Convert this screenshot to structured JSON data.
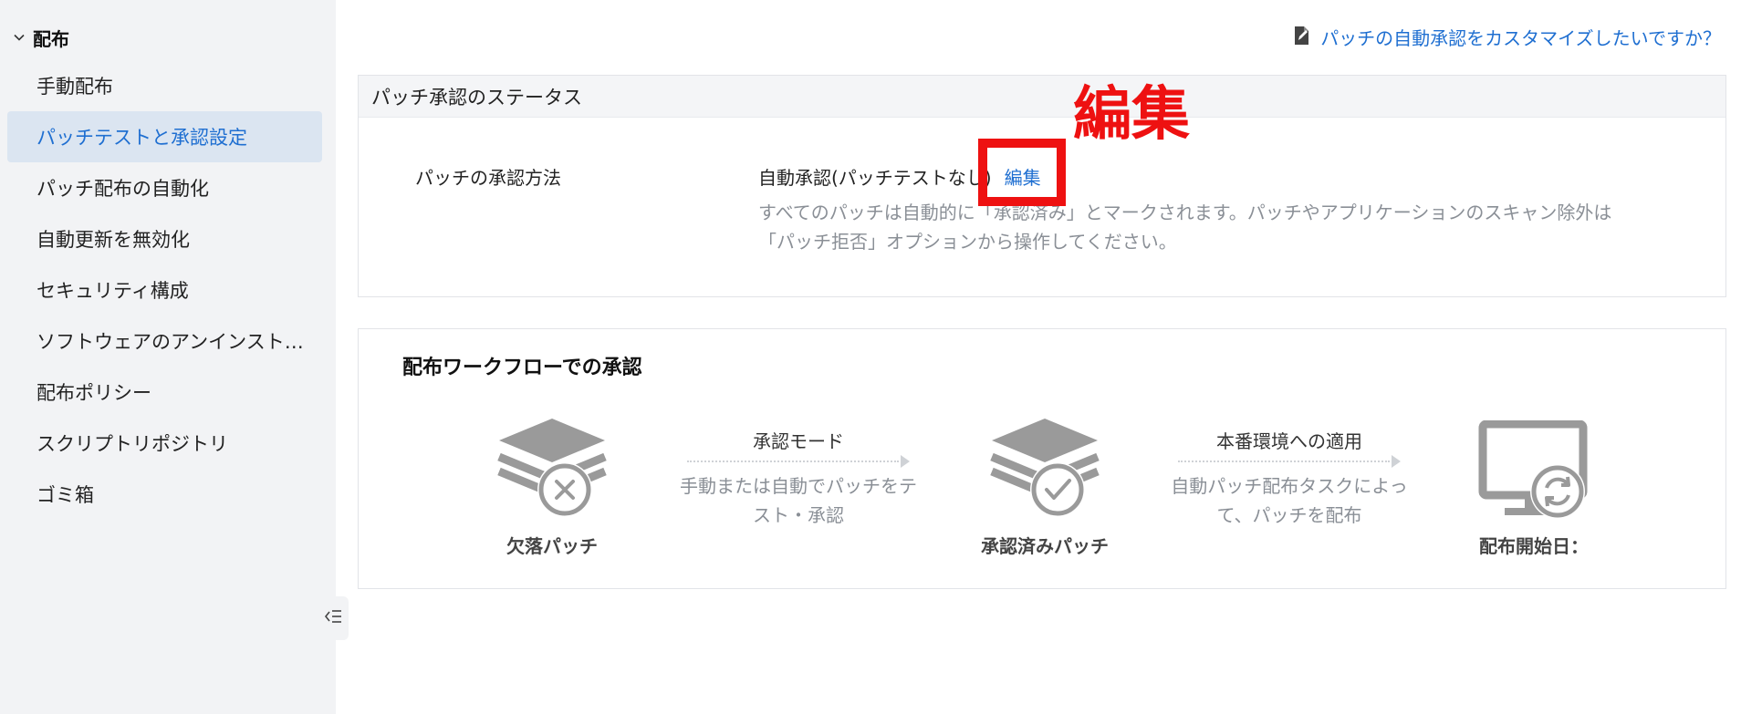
{
  "sidebar": {
    "section_title": "配布",
    "items": [
      {
        "label": "手動配布"
      },
      {
        "label": "パッチテストと承認設定"
      },
      {
        "label": "パッチ配布の自動化"
      },
      {
        "label": "自動更新を無効化"
      },
      {
        "label": "セキュリティ構成"
      },
      {
        "label": "ソフトウェアのアンインスト…"
      },
      {
        "label": "配布ポリシー"
      },
      {
        "label": "スクリプトリポジトリ"
      },
      {
        "label": "ゴミ箱"
      }
    ]
  },
  "header": {
    "help_link": "パッチの自動承認をカスタマイズしたいですか？"
  },
  "status_card": {
    "title": "パッチ承認のステータス",
    "approval_label": "パッチの承認方法",
    "approval_value": "自動承認(パッチテストなし)",
    "edit_label": "編集",
    "description_line1": "すべてのパッチは自動的に「承認済み」とマークされます。パッチやアプリケーションのスキャン除外は",
    "description_line2": "「パッチ拒否」オプションから操作してください。"
  },
  "annotation": {
    "text": "編集",
    "color": "#ee1111"
  },
  "workflow_card": {
    "title": "配布ワークフローでの承認",
    "stages": [
      {
        "label": "欠落パッチ",
        "icon": "layers-x-icon"
      },
      {
        "label": "承認済みパッチ",
        "icon": "layers-check-icon"
      },
      {
        "label": "配布開始日：",
        "icon": "monitor-sync-icon"
      }
    ],
    "steps": [
      {
        "name": "承認モード",
        "line1": "手動または自動でパッチをテ",
        "line2": "スト・承認"
      },
      {
        "name": "本番環境への適用",
        "line1": "自動パッチ配布タスクによっ",
        "line2": "て、パッチを配布"
      }
    ]
  },
  "colors": {
    "accent": "#1f6fd1",
    "sidebar_bg": "#f2f3f5",
    "active_bg": "#dbe5f1",
    "icon_gray": "#9a9a9a"
  }
}
